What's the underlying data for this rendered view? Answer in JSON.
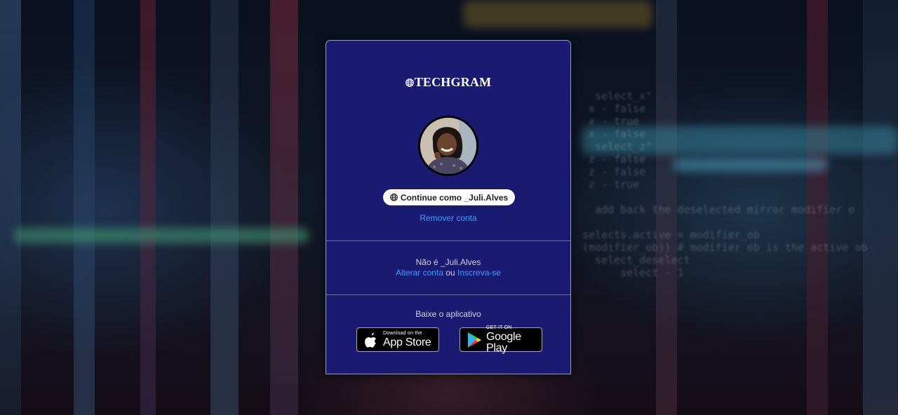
{
  "brand": {
    "name": "TECHGRAM"
  },
  "profile": {
    "continue_label": "Continue como _Juli.Alves",
    "remove_label": "Remover conta"
  },
  "switch_account": {
    "not_you": "Não é _Juli.Alves",
    "switch_label": "Alterar conta",
    "or_text": " ou ",
    "signup_label": "Inscreva-se"
  },
  "download": {
    "heading": "Baixe o aplicativo",
    "app_store": {
      "small": "Download on the",
      "big": "App Store"
    },
    "google_play": {
      "small": "GET IT ON",
      "big": "Google Play"
    }
  },
  "colors": {
    "card_bg": "#1a1a72",
    "link": "#3f9bff",
    "border": "#6c6ca4"
  },
  "icons": [
    "globe-icon",
    "apple-icon",
    "google-play-icon"
  ]
}
